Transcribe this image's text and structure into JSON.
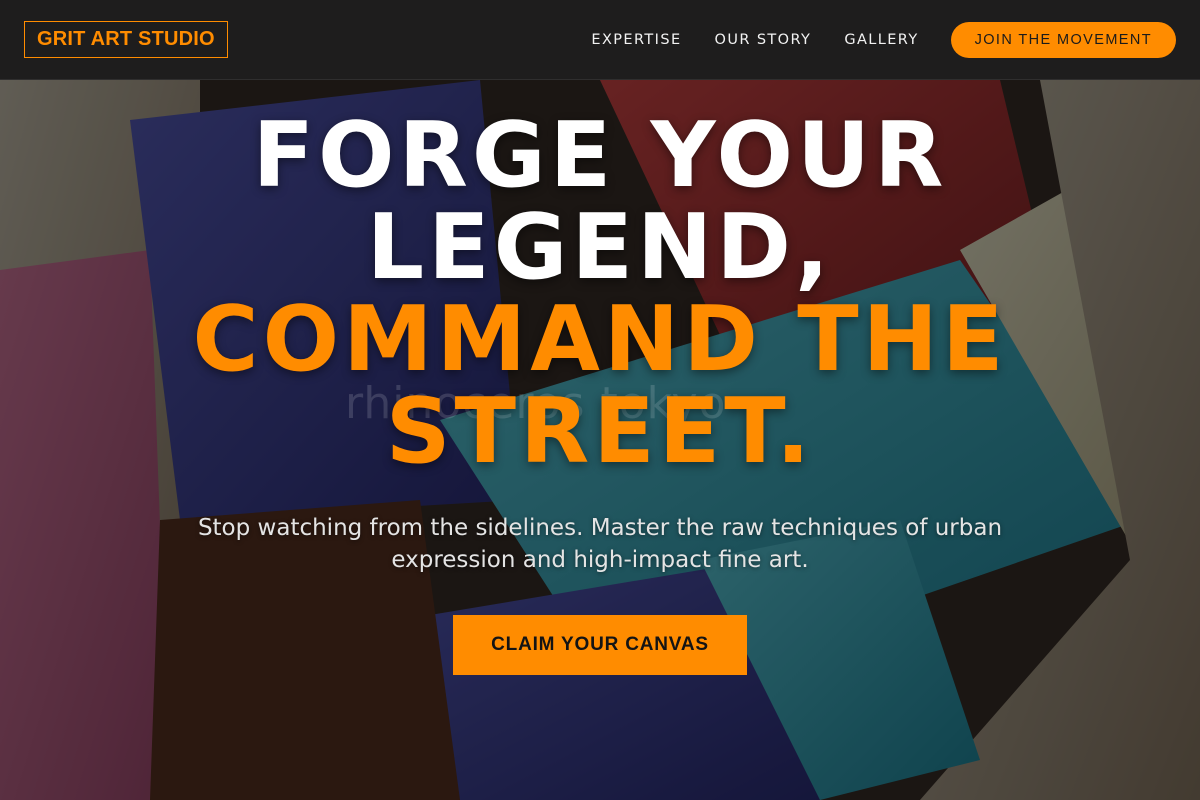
{
  "nav": {
    "logo": "GRIT ART STUDIO",
    "links": [
      "EXPERTISE",
      "OUR STORY",
      "GALLERY"
    ],
    "cta": "JOIN THE MOVEMENT"
  },
  "hero": {
    "headline_line1": "FORGE YOUR",
    "headline_line2": "LEGEND,",
    "headline_accent1": "COMMAND THE",
    "headline_accent2": "STREET.",
    "watermark": "rhinoceros tokyo",
    "subtitle": "Stop watching from the sidelines. Master the raw techniques of urban expression and high-impact fine art.",
    "cta": "CLAIM YOUR CANVAS"
  },
  "colors": {
    "accent": "#ff8c00",
    "nav_bg": "#1e1e1e",
    "text": "#ffffff"
  }
}
